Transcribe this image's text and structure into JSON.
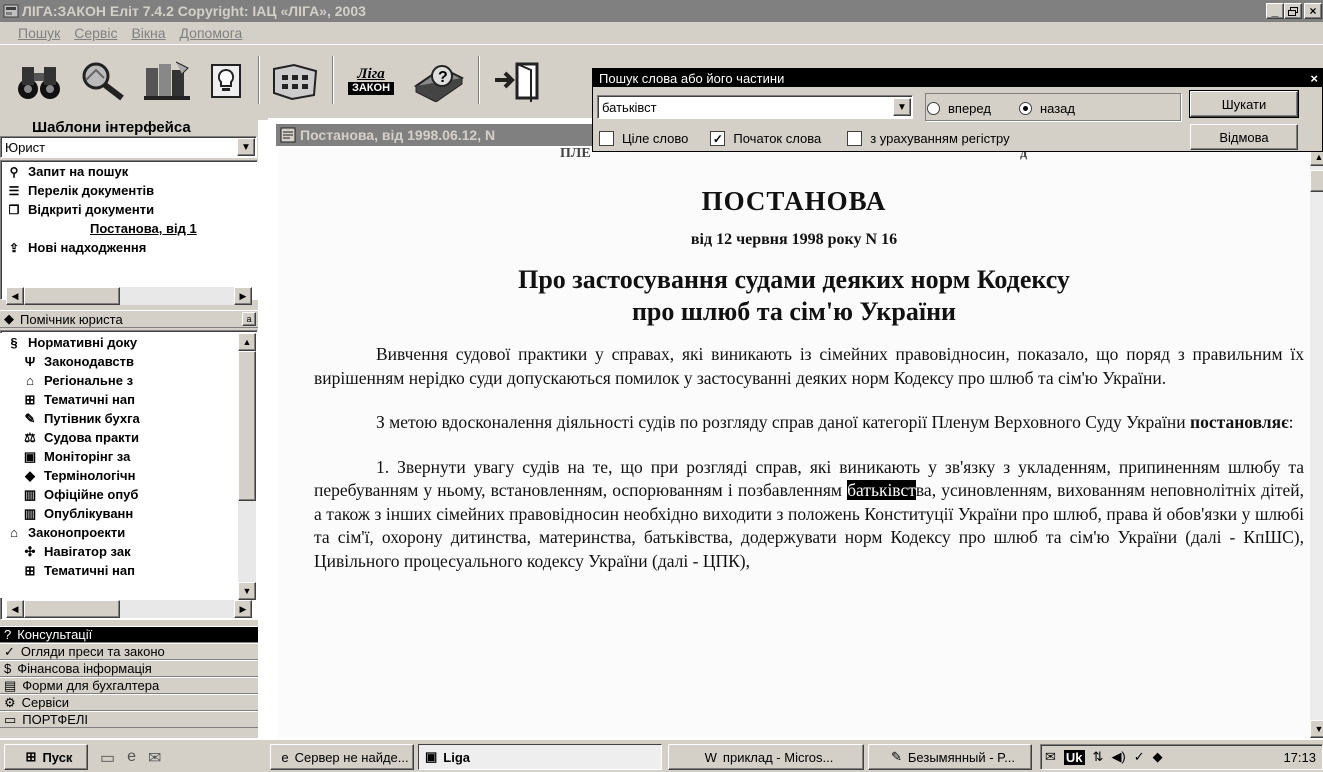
{
  "window": {
    "title": "ЛІГА:ЗАКОН Еліт 7.4.2 Copyright: ІАЦ «ЛІГА», 2003",
    "controls": [
      "_",
      "\u0000",
      "×"
    ]
  },
  "menu": [
    "Пошук",
    "Сервіс",
    "Вікна",
    "Допомога"
  ],
  "toolbar": {
    "liga_label_top": "Ліга",
    "liga_label_bottom": "ЗАКОН"
  },
  "left_panel": {
    "templates_label": "Шаблони інтерфейса",
    "template_value": "Юрист",
    "nav_items": [
      {
        "icon": "binoculars-icon",
        "glyph": "⚲",
        "label": "Запит на пошук"
      },
      {
        "icon": "list-icon",
        "glyph": "☰",
        "label": "Перелік документів"
      },
      {
        "icon": "documents-icon",
        "glyph": "❐",
        "label": "Відкриті документи"
      },
      {
        "icon": "",
        "glyph": "",
        "label": "Постанова, від 1"
      },
      {
        "icon": "new-arrivals-icon",
        "glyph": "⇪",
        "label": "Нові надходження"
      }
    ],
    "assistant_label": "Помічник юриста",
    "assistant_items": [
      {
        "icon": "law-icon",
        "glyph": "§",
        "label": "Нормативні доку",
        "indent": 0
      },
      {
        "icon": "trident-icon",
        "glyph": "Ψ",
        "label": "Законодавств",
        "indent": 1
      },
      {
        "icon": "map-icon",
        "glyph": "⌂",
        "label": "Регіональне з",
        "indent": 1
      },
      {
        "icon": "tree-icon",
        "glyph": "⊞",
        "label": "Тематичні нап",
        "indent": 1
      },
      {
        "icon": "pen-icon",
        "glyph": "✎",
        "label": "Путівник бухга",
        "indent": 1
      },
      {
        "icon": "scales-icon",
        "glyph": "⚖",
        "label": "Судова практи",
        "indent": 1
      },
      {
        "icon": "monitor-icon",
        "glyph": "▣",
        "label": "Моніторінг за",
        "indent": 1
      },
      {
        "icon": "sphere-icon",
        "glyph": "◆",
        "label": "Термінологічн",
        "indent": 1
      },
      {
        "icon": "book-icon",
        "glyph": "▥",
        "label": "Офіційне опуб",
        "indent": 1
      },
      {
        "icon": "book-icon",
        "glyph": "▥",
        "label": "Опублікуванн",
        "indent": 1
      },
      {
        "icon": "building-icon",
        "glyph": "⌂",
        "label": "Законопроекти",
        "indent": 0
      },
      {
        "icon": "navigator-icon",
        "glyph": "✣",
        "label": "Навігатор зак",
        "indent": 1
      },
      {
        "icon": "tree-icon",
        "glyph": "⊞",
        "label": "Тематичні нап",
        "indent": 1
      }
    ],
    "groups": [
      {
        "icon": "consult-icon",
        "glyph": "?",
        "label": "Консультації"
      },
      {
        "icon": "press-icon",
        "glyph": "✓",
        "label": "Огляди преси та законо"
      },
      {
        "icon": "finance-icon",
        "glyph": "$",
        "label": "Фінансова інформація"
      },
      {
        "icon": "forms-icon",
        "glyph": "▤",
        "label": "Форми для бухгалтера"
      },
      {
        "icon": "services-icon",
        "glyph": "⚙",
        "label": "Сервіси"
      },
      {
        "icon": "portfolio-icon",
        "glyph": "▭",
        "label": "ПОРТФЕЛІ"
      }
    ]
  },
  "document": {
    "tab_title": "Постанова, від 1998.06.12, N",
    "cut_header": "ПЛЕ",
    "cut_header_right": "д",
    "heading": "ПОСТАНОВА",
    "date_line": "від 12 червня 1998 року N 16",
    "title_line1": "Про застосування судами деяких норм Кодексу",
    "title_line2": "про шлюб та сім'ю України",
    "para1": "Вивчення судової практики у справах, які виникають із сімейних правовідносин, показало, що поряд з правильним їх вирішенням нерідко суди допускаються помилок у застосуванні деяких норм Кодексу про шлюб та сім'ю України.",
    "para2_start": "З метою вдосконалення діяльності судів по розгляду справ даної категорії Пленум Верховного Суду України ",
    "para2_bold": "постановляє",
    "para2_end": ":",
    "para3_start": "1. Звернути увагу судів на те, що при розгляді справ, які виникають у зв'язку з укладенням, припиненням шлюбу та перебуванням у ньому, встановленням, оспорюванням і позбавленням ",
    "para3_highlight": "батьківст",
    "para3_end": "ва, усиновленням, вихованням неповнолітніх дітей, а також з інших сімейних правовідносин необхідно виходити з положень Конституції України про шлюб, права й обов'язки у шлюбі та сім'ї, охорону дитинства, материнства, батьківства, додержувати норм Кодексу про шлюб та сім'ю України (далі - КпШС), Цивільного процесуального кодексу України (далі - ЦПК),"
  },
  "search_dialog": {
    "title": "Пошук слова або його частини",
    "query": "батьківст",
    "option_forward": "вперед",
    "option_backward": "назад",
    "direction": "назад",
    "whole_word_label": "Ціле слово",
    "whole_word_checked": false,
    "word_start_label": "Початок слова",
    "word_start_checked": true,
    "case_label": "з урахуванням регістру",
    "case_checked": false,
    "search_button": "Шукати",
    "cancel_button": "Відмова",
    "close": "×"
  },
  "taskbar": {
    "start": "Пуск",
    "tasks": [
      {
        "icon": "ie-icon",
        "label": "Сервер не найде..."
      },
      {
        "icon": "liga-icon",
        "label": "Liga"
      },
      {
        "icon": "word-icon",
        "label": "приклад - Micros..."
      },
      {
        "icon": "paint-icon",
        "label": "Безымянный - P..."
      }
    ],
    "tray_lang": "Uk",
    "clock": "17:13"
  }
}
